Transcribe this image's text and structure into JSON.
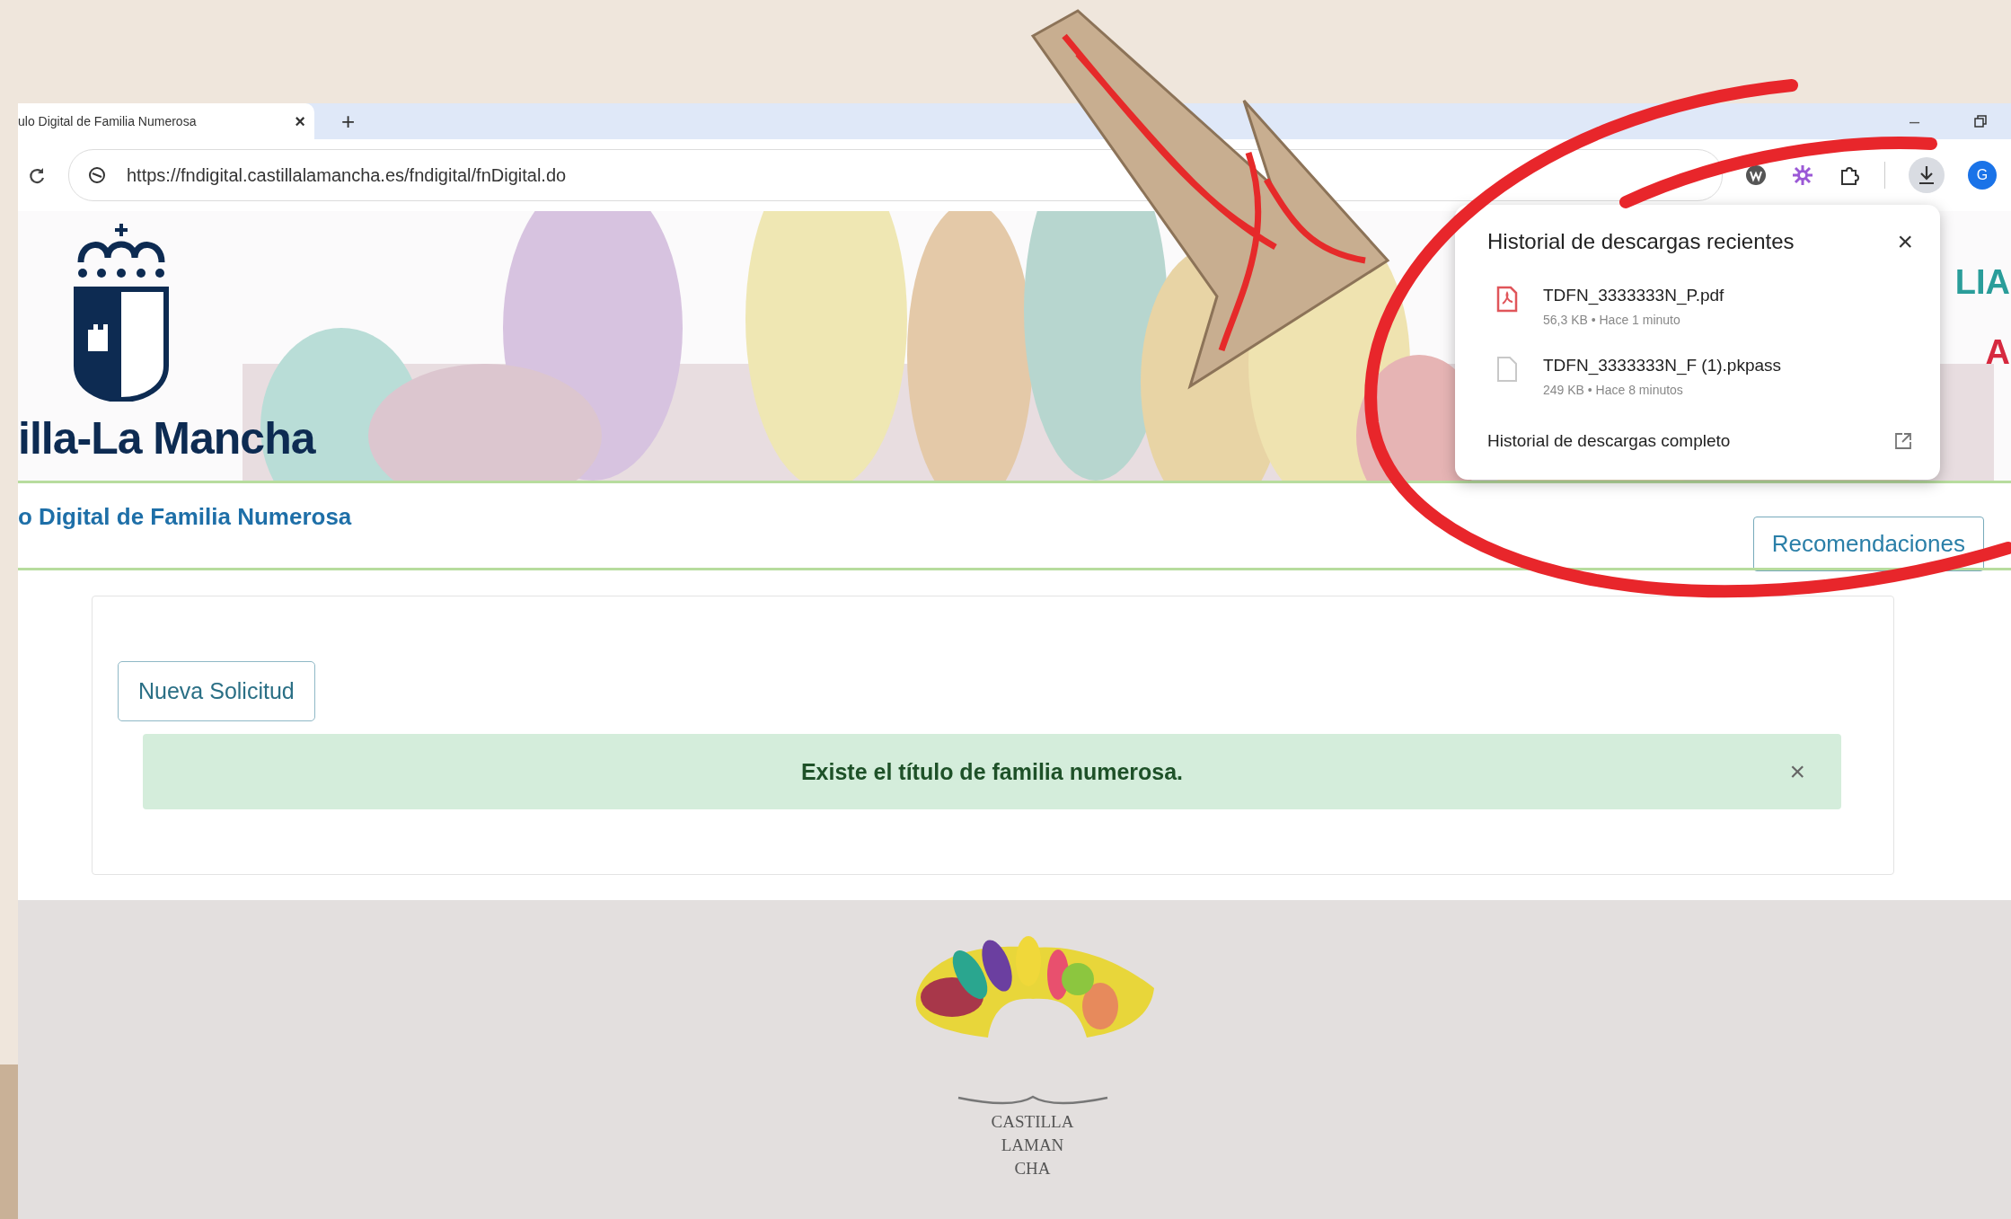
{
  "browser": {
    "tab": {
      "title": "ulo Digital de Familia Numerosa",
      "close": "×",
      "selected": true
    },
    "new_tab": "+",
    "minimize": "–",
    "url": "https://fndigital.castillalamancha.es/fndigital/fnDigital.do",
    "profile": "G"
  },
  "header": {
    "region_name": "illa-La Mancha",
    "title_fragments": [
      {
        "text": "LIA",
        "color": "#2a9d9a"
      },
      {
        "text": "A",
        "color": "#d6293f"
      }
    ]
  },
  "nav": {
    "title": "o Digital de Familia Numerosa",
    "button": "Recomendaciones"
  },
  "content": {
    "button": "Nueva Solicitud",
    "alert": {
      "text": "Existe el título de familia numerosa.",
      "close": "×"
    }
  },
  "footer": {
    "logo_lines": [
      "CASTILLA",
      "LAMAN",
      "CHA"
    ]
  },
  "downloads_popup": {
    "title": "Historial de descargas recientes",
    "close": "×",
    "items": [
      {
        "kind": "pdf",
        "name": "TDFN_3333333N_P.pdf",
        "meta": "56,3 KB • Hace 1 minuto"
      },
      {
        "kind": "file",
        "name": "TDFN_3333333N_F (1).pkpass",
        "meta": "249 KB • Hace 8 minutos"
      }
    ],
    "footer_link": "Historial de descargas completo"
  },
  "annotations": {
    "arrow": true,
    "red_circle": true
  }
}
